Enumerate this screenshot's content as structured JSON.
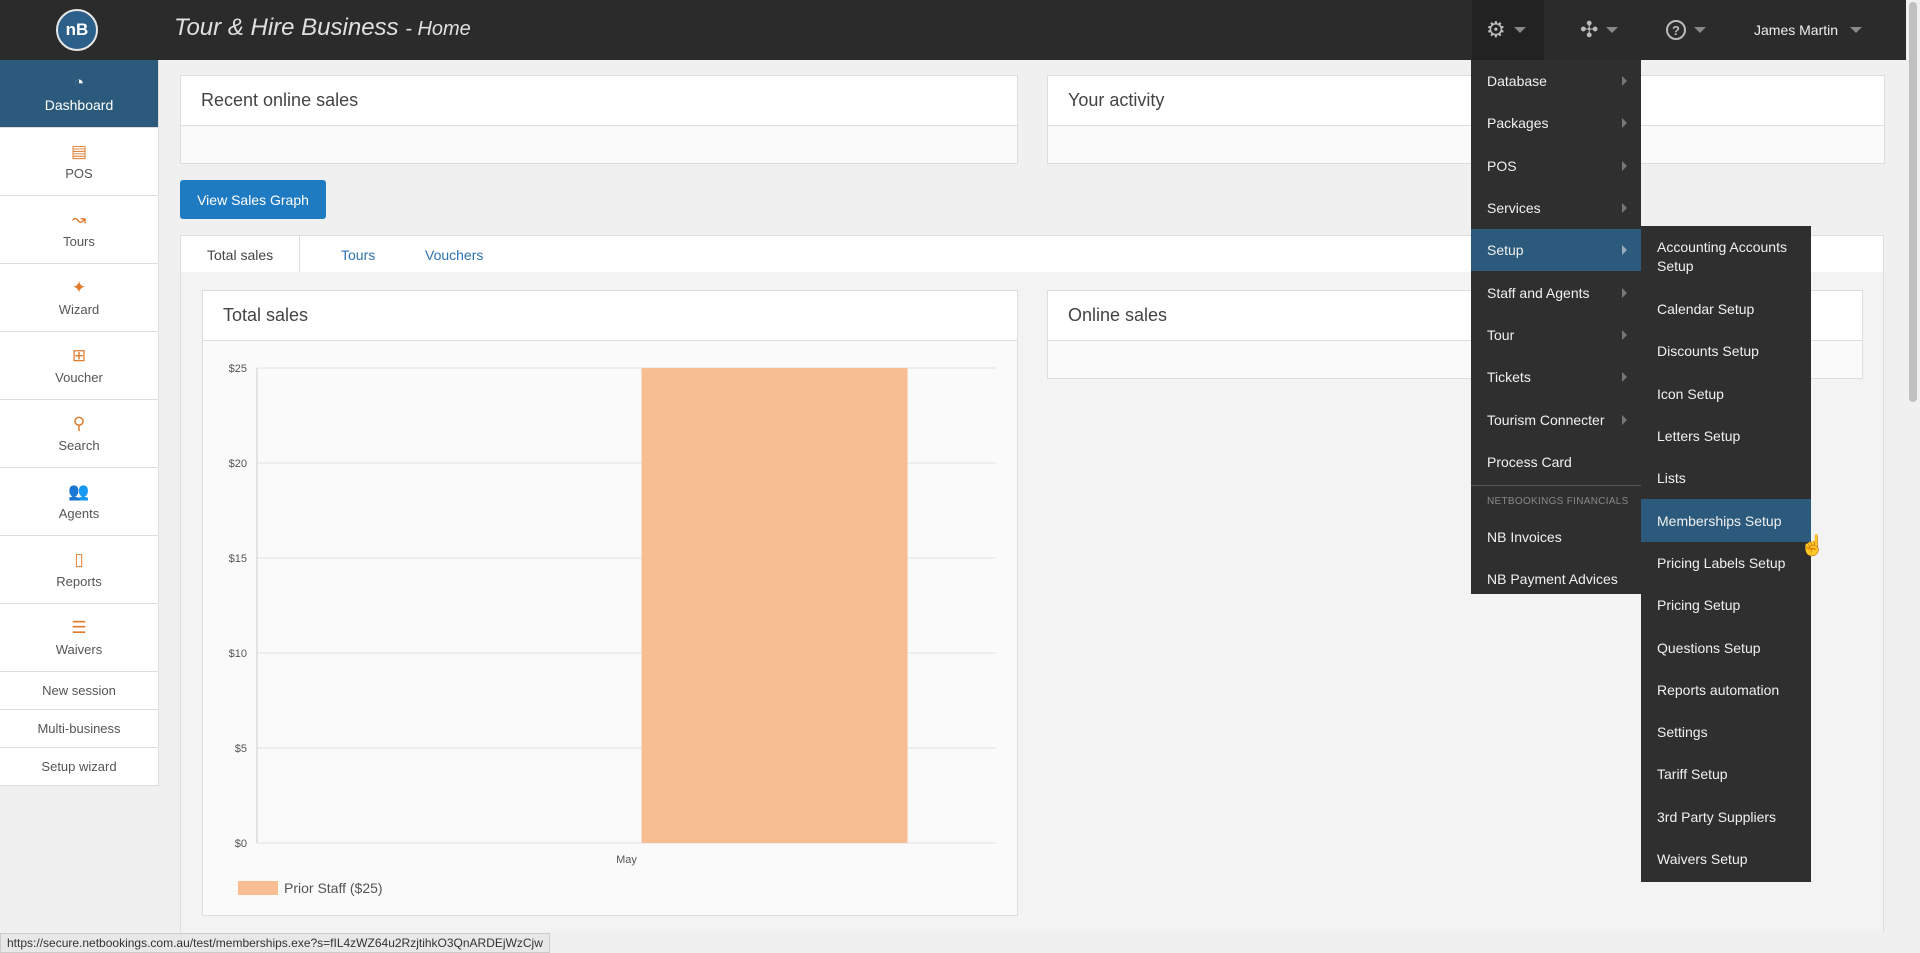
{
  "header": {
    "logo_text": "nB",
    "title": "Tour & Hire Business",
    "subtitle": "Home",
    "user_name": "James Martin",
    "icons": [
      "gears-icon",
      "settings-alt-icon",
      "help-icon"
    ]
  },
  "sidebar": {
    "items": [
      {
        "label": "Dashboard",
        "icon": "dashboard-icon",
        "active": true
      },
      {
        "label": "POS",
        "icon": "cash-register-icon"
      },
      {
        "label": "Tours",
        "icon": "route-icon"
      },
      {
        "label": "Wizard",
        "icon": "magic-wand-icon"
      },
      {
        "label": "Voucher",
        "icon": "gift-icon"
      },
      {
        "label": "Search",
        "icon": "search-icon"
      },
      {
        "label": "Agents",
        "icon": "users-icon"
      },
      {
        "label": "Reports",
        "icon": "document-icon"
      },
      {
        "label": "Waivers",
        "icon": "checklist-icon"
      }
    ],
    "links": [
      "New session",
      "Multi-business",
      "Setup wizard"
    ]
  },
  "panels": {
    "recent_sales": "Recent online sales",
    "your_activity": "Your activity",
    "total_sales": "Total sales",
    "online_sales": "Online sales"
  },
  "buttons": {
    "view_sales_graph": "View Sales Graph"
  },
  "tabs": [
    "Total sales",
    "Tours",
    "Vouchers"
  ],
  "chart_data": {
    "type": "bar",
    "categories": [
      "May"
    ],
    "series": [
      {
        "name": "Prior Staff ($25)",
        "values": [
          25
        ],
        "color": "#f7be94"
      }
    ],
    "ylim": [
      0,
      25
    ],
    "yticks": [
      "$0",
      "$5",
      "$10",
      "$15",
      "$20",
      "$25"
    ],
    "grid": true,
    "legend": "bottom-left"
  },
  "menu": {
    "items": [
      {
        "label": "Database",
        "submenu": true
      },
      {
        "label": "Packages",
        "submenu": true
      },
      {
        "label": "POS",
        "submenu": true
      },
      {
        "label": "Services",
        "submenu": true
      },
      {
        "label": "Setup",
        "submenu": true,
        "active": true
      },
      {
        "label": "Staff and Agents",
        "submenu": true
      },
      {
        "label": "Tour",
        "submenu": true
      },
      {
        "label": "Tickets",
        "submenu": true
      },
      {
        "label": "Tourism Connecter",
        "submenu": true
      },
      {
        "label": "Process Card",
        "submenu": false
      }
    ],
    "section_header": "NETBOOKINGS FINANCIALS",
    "financial_items": [
      "NB Invoices",
      "NB Payment Advices"
    ]
  },
  "setup_submenu": {
    "items": [
      "Accounting Accounts Setup",
      "Calendar Setup",
      "Discounts Setup",
      "Icon Setup",
      "Letters Setup",
      "Lists",
      "Memberships Setup",
      "Pricing Labels Setup",
      "Pricing Setup",
      "Questions Setup",
      "Reports automation",
      "Settings",
      "Tariff Setup",
      "3rd Party Suppliers",
      "Waivers Setup"
    ],
    "active_index": 6
  },
  "status_bar": {
    "url": "https://secure.netbookings.com.au/test/memberships.exe?s=fIL4zWZ64u2RzjtihkO3QnARDEjWzCjw"
  },
  "colors": {
    "topbar": "#2b2b2b",
    "accent_blue": "#1f7bc1",
    "active_nav": "#2c5a7c",
    "icon_orange": "#e07b2e",
    "bar_fill": "#f7be94"
  }
}
